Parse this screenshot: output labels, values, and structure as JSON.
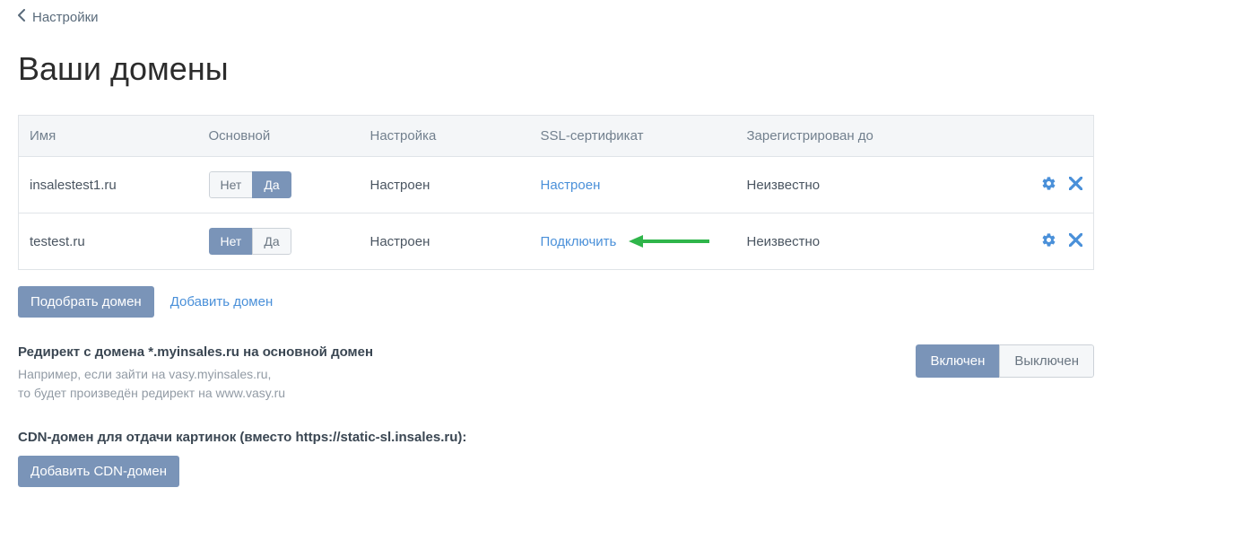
{
  "breadcrumb": {
    "label": "Настройки"
  },
  "pageTitle": "Ваши домены",
  "columns": {
    "name": "Имя",
    "main": "Основной",
    "setup": "Настройка",
    "ssl": "SSL-сертификат",
    "registered": "Зарегистрирован до"
  },
  "toggle": {
    "no": "Нет",
    "yes": "Да"
  },
  "domains": [
    {
      "name": "insalestest1.ru",
      "mainActive": "yes",
      "setup": "Настроен",
      "ssl": "Настроен",
      "sslIsLink": true,
      "registered": "Неизвестно"
    },
    {
      "name": "testest.ru",
      "mainActive": "no",
      "setup": "Настроен",
      "ssl": "Подключить",
      "sslIsLink": true,
      "registered": "Неизвестно",
      "arrow": true
    }
  ],
  "buttons": {
    "pickDomain": "Подобрать домен",
    "addDomain": "Добавить домен",
    "addCdn": "Добавить CDN-домен"
  },
  "redirect": {
    "title": "Редирект с домена *.myinsales.ru на основной домен",
    "hint1": "Например, если зайти на vasy.myinsales.ru,",
    "hint2": "то будет произведён редирект на www.vasy.ru",
    "on": "Включен",
    "off": "Выключен",
    "active": "on"
  },
  "cdn": {
    "title": "CDN-домен для отдачи картинок (вместо https://static-sl.insales.ru):"
  },
  "colors": {
    "primary": "#7a94b8",
    "link": "#4a90d9",
    "arrow": "#2fb54a"
  }
}
